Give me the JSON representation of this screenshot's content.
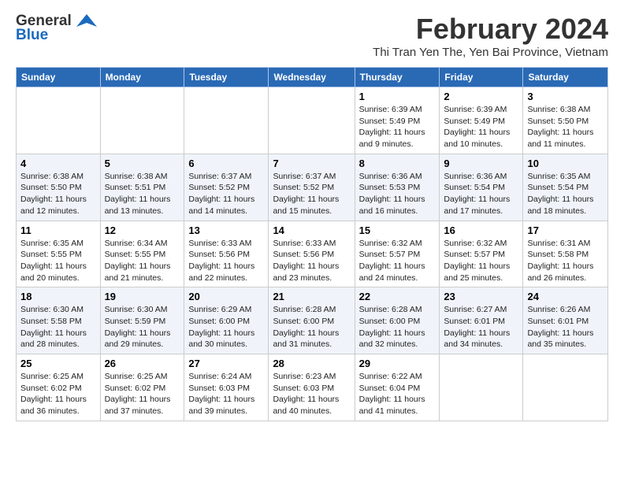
{
  "logo": {
    "general": "General",
    "blue": "Blue"
  },
  "header": {
    "month_year": "February 2024",
    "location": "Thi Tran Yen The, Yen Bai Province, Vietnam"
  },
  "weekdays": [
    "Sunday",
    "Monday",
    "Tuesday",
    "Wednesday",
    "Thursday",
    "Friday",
    "Saturday"
  ],
  "weeks": [
    [
      {
        "day": "",
        "info": ""
      },
      {
        "day": "",
        "info": ""
      },
      {
        "day": "",
        "info": ""
      },
      {
        "day": "",
        "info": ""
      },
      {
        "day": "1",
        "info": "Sunrise: 6:39 AM\nSunset: 5:49 PM\nDaylight: 11 hours and 9 minutes."
      },
      {
        "day": "2",
        "info": "Sunrise: 6:39 AM\nSunset: 5:49 PM\nDaylight: 11 hours and 10 minutes."
      },
      {
        "day": "3",
        "info": "Sunrise: 6:38 AM\nSunset: 5:50 PM\nDaylight: 11 hours and 11 minutes."
      }
    ],
    [
      {
        "day": "4",
        "info": "Sunrise: 6:38 AM\nSunset: 5:50 PM\nDaylight: 11 hours and 12 minutes."
      },
      {
        "day": "5",
        "info": "Sunrise: 6:38 AM\nSunset: 5:51 PM\nDaylight: 11 hours and 13 minutes."
      },
      {
        "day": "6",
        "info": "Sunrise: 6:37 AM\nSunset: 5:52 PM\nDaylight: 11 hours and 14 minutes."
      },
      {
        "day": "7",
        "info": "Sunrise: 6:37 AM\nSunset: 5:52 PM\nDaylight: 11 hours and 15 minutes."
      },
      {
        "day": "8",
        "info": "Sunrise: 6:36 AM\nSunset: 5:53 PM\nDaylight: 11 hours and 16 minutes."
      },
      {
        "day": "9",
        "info": "Sunrise: 6:36 AM\nSunset: 5:54 PM\nDaylight: 11 hours and 17 minutes."
      },
      {
        "day": "10",
        "info": "Sunrise: 6:35 AM\nSunset: 5:54 PM\nDaylight: 11 hours and 18 minutes."
      }
    ],
    [
      {
        "day": "11",
        "info": "Sunrise: 6:35 AM\nSunset: 5:55 PM\nDaylight: 11 hours and 20 minutes."
      },
      {
        "day": "12",
        "info": "Sunrise: 6:34 AM\nSunset: 5:55 PM\nDaylight: 11 hours and 21 minutes."
      },
      {
        "day": "13",
        "info": "Sunrise: 6:33 AM\nSunset: 5:56 PM\nDaylight: 11 hours and 22 minutes."
      },
      {
        "day": "14",
        "info": "Sunrise: 6:33 AM\nSunset: 5:56 PM\nDaylight: 11 hours and 23 minutes."
      },
      {
        "day": "15",
        "info": "Sunrise: 6:32 AM\nSunset: 5:57 PM\nDaylight: 11 hours and 24 minutes."
      },
      {
        "day": "16",
        "info": "Sunrise: 6:32 AM\nSunset: 5:57 PM\nDaylight: 11 hours and 25 minutes."
      },
      {
        "day": "17",
        "info": "Sunrise: 6:31 AM\nSunset: 5:58 PM\nDaylight: 11 hours and 26 minutes."
      }
    ],
    [
      {
        "day": "18",
        "info": "Sunrise: 6:30 AM\nSunset: 5:58 PM\nDaylight: 11 hours and 28 minutes."
      },
      {
        "day": "19",
        "info": "Sunrise: 6:30 AM\nSunset: 5:59 PM\nDaylight: 11 hours and 29 minutes."
      },
      {
        "day": "20",
        "info": "Sunrise: 6:29 AM\nSunset: 6:00 PM\nDaylight: 11 hours and 30 minutes."
      },
      {
        "day": "21",
        "info": "Sunrise: 6:28 AM\nSunset: 6:00 PM\nDaylight: 11 hours and 31 minutes."
      },
      {
        "day": "22",
        "info": "Sunrise: 6:28 AM\nSunset: 6:00 PM\nDaylight: 11 hours and 32 minutes."
      },
      {
        "day": "23",
        "info": "Sunrise: 6:27 AM\nSunset: 6:01 PM\nDaylight: 11 hours and 34 minutes."
      },
      {
        "day": "24",
        "info": "Sunrise: 6:26 AM\nSunset: 6:01 PM\nDaylight: 11 hours and 35 minutes."
      }
    ],
    [
      {
        "day": "25",
        "info": "Sunrise: 6:25 AM\nSunset: 6:02 PM\nDaylight: 11 hours and 36 minutes."
      },
      {
        "day": "26",
        "info": "Sunrise: 6:25 AM\nSunset: 6:02 PM\nDaylight: 11 hours and 37 minutes."
      },
      {
        "day": "27",
        "info": "Sunrise: 6:24 AM\nSunset: 6:03 PM\nDaylight: 11 hours and 39 minutes."
      },
      {
        "day": "28",
        "info": "Sunrise: 6:23 AM\nSunset: 6:03 PM\nDaylight: 11 hours and 40 minutes."
      },
      {
        "day": "29",
        "info": "Sunrise: 6:22 AM\nSunset: 6:04 PM\nDaylight: 11 hours and 41 minutes."
      },
      {
        "day": "",
        "info": ""
      },
      {
        "day": "",
        "info": ""
      }
    ]
  ]
}
